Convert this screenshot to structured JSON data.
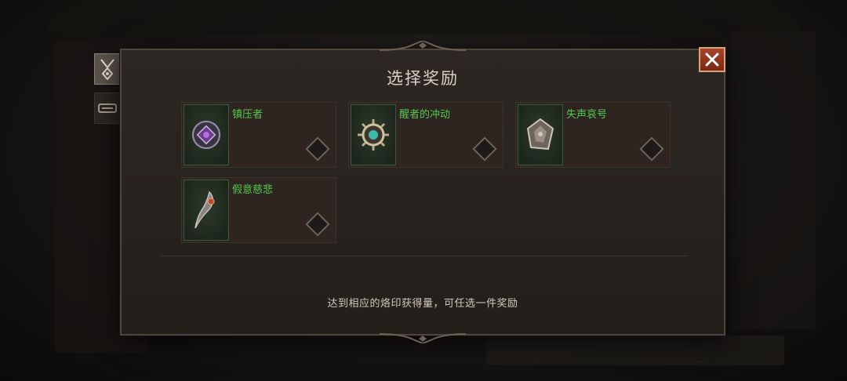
{
  "dialog": {
    "title": "选择奖励",
    "hint": "达到相应的烙印获得量，可任选一件奖励"
  },
  "rewards": [
    {
      "name": "镇压者",
      "icon": "amulet-icon"
    },
    {
      "name": "醒者的冲动",
      "icon": "wheel-charm-icon"
    },
    {
      "name": "失声哀号",
      "icon": "rune-stone-icon"
    },
    {
      "name": "假意慈悲",
      "icon": "claw-dagger-icon"
    }
  ],
  "side_tabs": [
    {
      "icon": "pendant-icon",
      "active": true
    },
    {
      "icon": "bracer-icon",
      "active": false
    }
  ],
  "colors": {
    "item_name": "#52c94f",
    "close_button": "#9a3a22",
    "title": "#d8d2c6"
  }
}
